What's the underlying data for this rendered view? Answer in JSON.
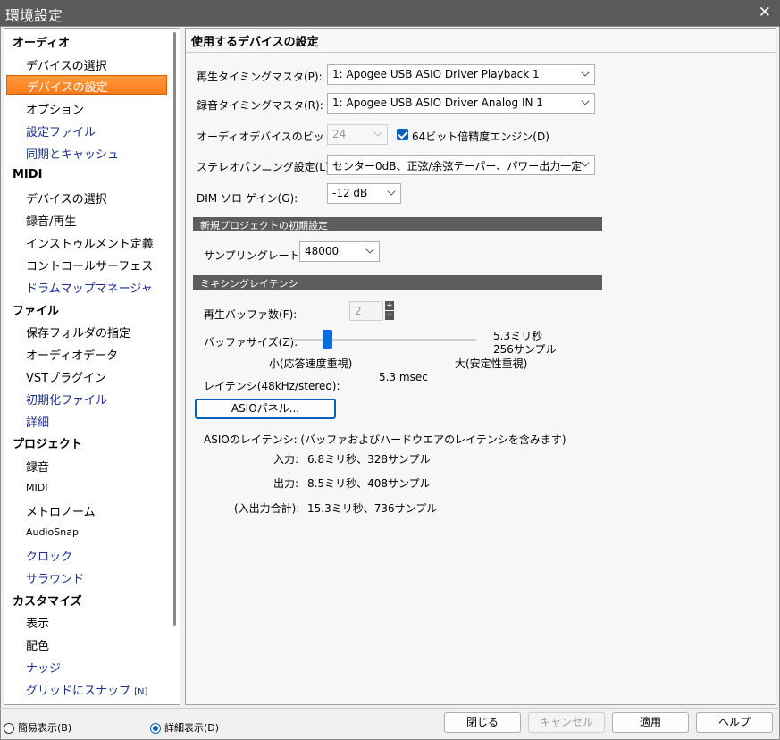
{
  "window": {
    "title": "環境設定",
    "close_label": "✕"
  },
  "sidebar": {
    "categories": [
      {
        "label": "オーディオ",
        "items": [
          {
            "label": "デバイスの選択",
            "link": false
          },
          {
            "label": "デバイスの設定",
            "link": false,
            "selected": true
          },
          {
            "label": "オプション",
            "link": false
          },
          {
            "label": "設定ファイル",
            "link": true
          },
          {
            "label": "同期とキャッシュ",
            "link": true
          }
        ]
      },
      {
        "label": "MIDI",
        "items": [
          {
            "label": "デバイスの選択",
            "link": false
          },
          {
            "label": "録音/再生",
            "link": false
          },
          {
            "label": "インストゥルメント定義",
            "link": false
          },
          {
            "label": "コントロールサーフェス",
            "link": false
          },
          {
            "label": "ドラムマップマネージャ",
            "link": true
          }
        ]
      },
      {
        "label": "ファイル",
        "items": [
          {
            "label": "保存フォルダの指定",
            "link": false
          },
          {
            "label": "オーディオデータ",
            "link": false
          },
          {
            "label": "VSTプラグイン",
            "link": false
          },
          {
            "label": "初期化ファイル",
            "link": true
          },
          {
            "label": "詳細",
            "link": true
          }
        ]
      },
      {
        "label": "プロジェクト",
        "items": [
          {
            "label": "録音",
            "link": false
          },
          {
            "label": "MIDI",
            "link": false
          },
          {
            "label": "メトロノーム",
            "link": false
          },
          {
            "label": "AudioSnap",
            "link": false
          },
          {
            "label": "クロック",
            "link": true
          },
          {
            "label": "サラウンド",
            "link": true
          }
        ]
      },
      {
        "label": "カスタマイズ",
        "items": [
          {
            "label": "表示",
            "link": false
          },
          {
            "label": "配色",
            "link": false
          },
          {
            "label": "ナッジ",
            "link": true
          },
          {
            "label": "グリッドにスナップ",
            "link": true,
            "suffix": "[N]"
          }
        ]
      }
    ],
    "view_simple": "簡易表示(B)",
    "view_detail": "詳細表示(D)"
  },
  "main": {
    "title": "使用するデバイスの設定",
    "playback_master_label": "再生タイミングマスタ(P):",
    "playback_master_value": "1: Apogee USB ASIO Driver Playback 1",
    "record_master_label": "録音タイミングマスタ(R):",
    "record_master_value": "1: Apogee USB ASIO Driver Analog IN 1",
    "bitdepth_label": "オーディオデバイスのビット数(T):",
    "bitdepth_value": "24",
    "engine64_label": "64ビット倍精度エンジン(D)",
    "panning_label": "ステレオパンニング設定(L):",
    "panning_value": "センター0dB、正弦/余弦テーパー、パワー出力一定",
    "dim_label": "DIM ソロ ゲイン(G):",
    "dim_value": "-12 dB",
    "new_project_section": "新規プロジェクトの初期設定",
    "sampling_label": "サンプリングレート(S):",
    "sampling_value": "48000",
    "latency_section": "ミキシングレイテンシ",
    "buffer_count_label": "再生バッファ数(F):",
    "buffer_count_value": "2",
    "buffer_size_label": "バッファサイズ(Z):",
    "buffer_ms": "5.3ミリ秒",
    "buffer_samples": "256サンプル",
    "slider_min_label": "小(応答速度重視)",
    "slider_max_label": "大(安定性重視)",
    "latency_label": "レイテンシ(48kHz/stereo):",
    "latency_value": "5.3 msec",
    "asio_panel_button": "ASIOパネル...",
    "asio_latency_label": "ASIOのレイテンシ: (バッファおよびハードウエアのレイテンシを含みます)",
    "input_label": "入力:",
    "input_value": "6.8ミリ秒、328サンプル",
    "output_label": "出力:",
    "output_value": "8.5ミリ秒、408サンプル",
    "total_label": "(入出力合計):",
    "total_value": "15.3ミリ秒、736サンプル"
  },
  "footer": {
    "close_button": "閉じる",
    "cancel_button": "キャンセル",
    "apply_button": "適用",
    "help_button": "ヘルプ"
  }
}
